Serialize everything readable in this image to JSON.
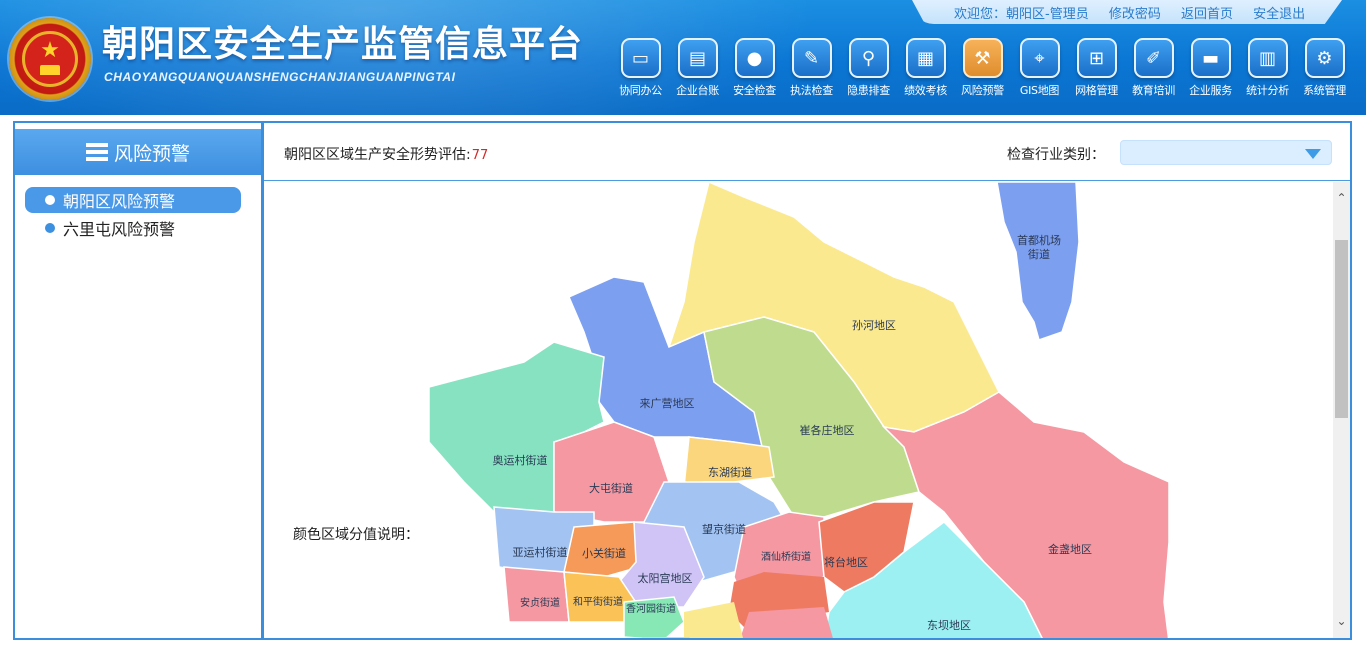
{
  "header": {
    "title": "朝阳区安全生产监管信息平台",
    "subtitle": "CHAOYANGQUANQUANSHENGCHANJIANGUANPINGTAI",
    "user_links": [
      "欢迎您：朝阳区-管理员",
      "修改密码",
      "返回首页",
      "安全退出"
    ],
    "nav": [
      {
        "label": "协同办公",
        "icon": "monitor-icon"
      },
      {
        "label": "企业台账",
        "icon": "folder-icon"
      },
      {
        "label": "安全检查",
        "icon": "inspector-icon"
      },
      {
        "label": "执法检查",
        "icon": "document-pen-icon"
      },
      {
        "label": "隐患排查",
        "icon": "magnifier-icon"
      },
      {
        "label": "绩效考核",
        "icon": "clipboard-icon"
      },
      {
        "label": "风险预警",
        "icon": "gavel-icon",
        "active": true
      },
      {
        "label": "GIS地图",
        "icon": "map-pin-icon"
      },
      {
        "label": "网格管理",
        "icon": "grid-map-icon"
      },
      {
        "label": "教育培训",
        "icon": "edit-board-icon"
      },
      {
        "label": "企业服务",
        "icon": "printer-icon"
      },
      {
        "label": "统计分析",
        "icon": "bar-chart-icon"
      },
      {
        "label": "系统管理",
        "icon": "settings-monitor-icon"
      }
    ]
  },
  "sidebar": {
    "title": "风险预警",
    "items": [
      {
        "label": "朝阳区风险预警",
        "active": true
      },
      {
        "label": "六里屯风险预警",
        "active": false
      }
    ]
  },
  "main": {
    "assessment_label": "朝阳区区域生产安全形势评估:",
    "assessment_score": "77",
    "filter_label": "检查行业类别：",
    "filter_value": "",
    "legend_label": "颜色区域分值说明："
  },
  "map": {
    "regions": [
      {
        "name": "首都机场街道",
        "color": "#7d9ff0"
      },
      {
        "name": "孙河地区",
        "color": "#fbe98f"
      },
      {
        "name": "来广营地区",
        "color": "#7d9ff0"
      },
      {
        "name": "崔各庄地区",
        "color": "#bfdc8e"
      },
      {
        "name": "奥运村街道",
        "color": "#87e2c2"
      },
      {
        "name": "大屯街道",
        "color": "#f598a2"
      },
      {
        "name": "东湖街道",
        "color": "#fbd67c"
      },
      {
        "name": "望京街道",
        "color": "#a3c4f3"
      },
      {
        "name": "金盏地区",
        "color": "#f598a2"
      },
      {
        "name": "亚运村街道",
        "color": "#a3c4f3"
      },
      {
        "name": "小关街道",
        "color": "#f59a58"
      },
      {
        "name": "酒仙桥街道",
        "color": "#f598a2"
      },
      {
        "name": "将台地区",
        "color": "#ee7a62"
      },
      {
        "name": "太阳宫地区",
        "color": "#cfc4f5"
      },
      {
        "name": "安贞街道",
        "color": "#f598a2"
      },
      {
        "name": "和平街街道",
        "color": "#fbc257"
      },
      {
        "name": "香河园街道",
        "color": "#87e8b6"
      },
      {
        "name": "东坝地区",
        "color": "#9cf0f2"
      }
    ]
  }
}
